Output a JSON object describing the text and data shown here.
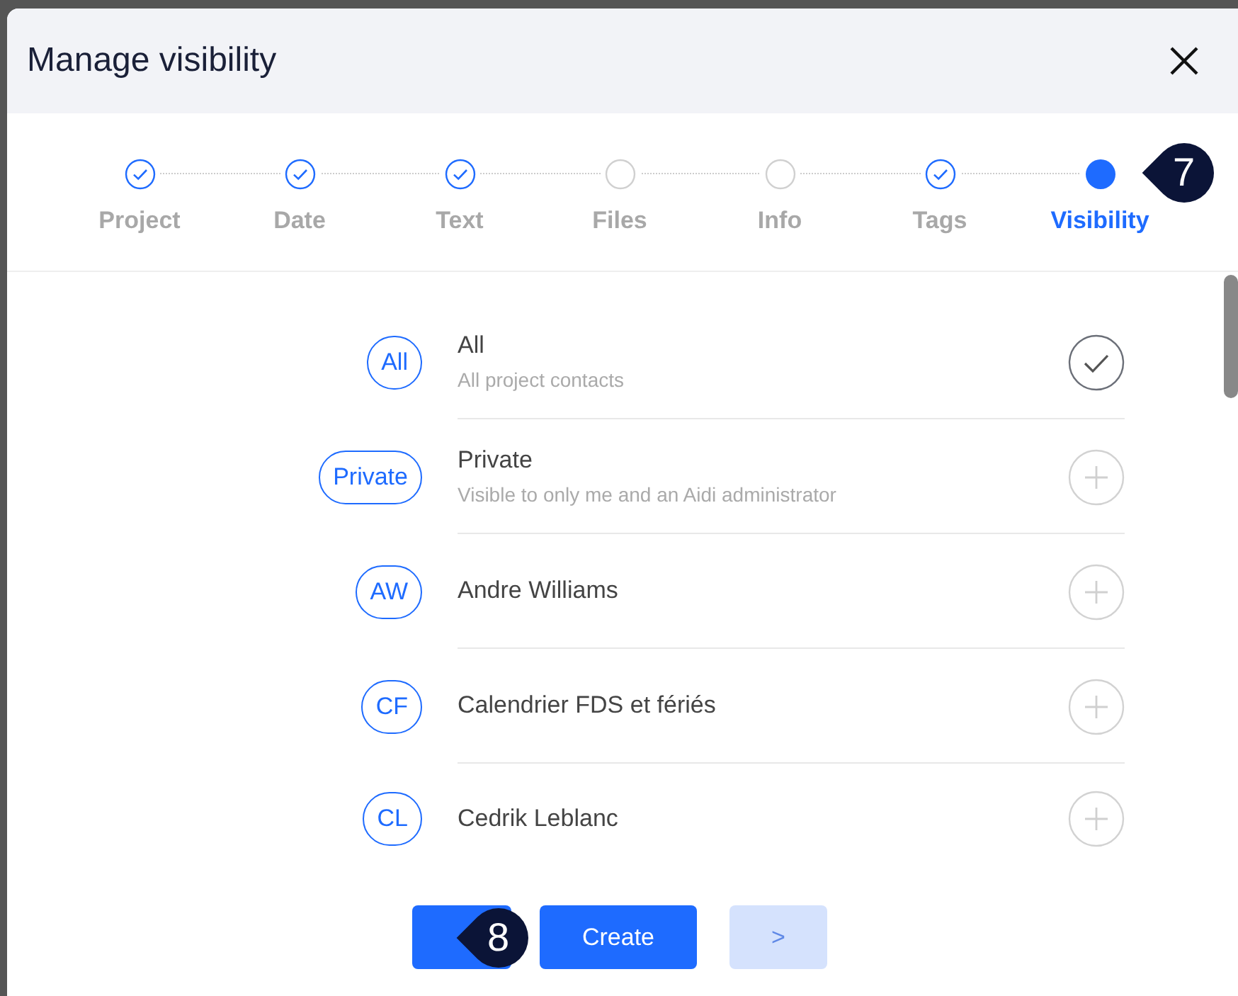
{
  "dialog": {
    "title": "Manage visibility"
  },
  "steps": [
    {
      "label": "Project",
      "completed": true,
      "selected": false
    },
    {
      "label": "Date",
      "completed": true,
      "selected": false
    },
    {
      "label": "Text",
      "completed": true,
      "selected": false
    },
    {
      "label": "Files",
      "completed": false,
      "selected": false
    },
    {
      "label": "Info",
      "completed": false,
      "selected": false
    },
    {
      "label": "Tags",
      "completed": true,
      "selected": false
    },
    {
      "label": "Visibility",
      "selected": true
    }
  ],
  "options": [
    {
      "badge": "All",
      "name": "All",
      "description": "All project contacts",
      "selected": true
    },
    {
      "badge": "Private",
      "name": "Private",
      "description": "Visible to only me and an Aidi administrator",
      "selected": false
    },
    {
      "badge": "AW",
      "name": "Andre Williams",
      "selected": false
    },
    {
      "badge": "CF",
      "name": "Calendrier FDS et fériés",
      "selected": false
    },
    {
      "badge": "CL",
      "name": "Cedrik Leblanc",
      "selected": false
    }
  ],
  "footer": {
    "primary": "Create",
    "next": {
      "label": ">",
      "disabled": true
    }
  },
  "stepper_callout": {
    "number": "7"
  },
  "footer_callout": {
    "number": "8"
  }
}
